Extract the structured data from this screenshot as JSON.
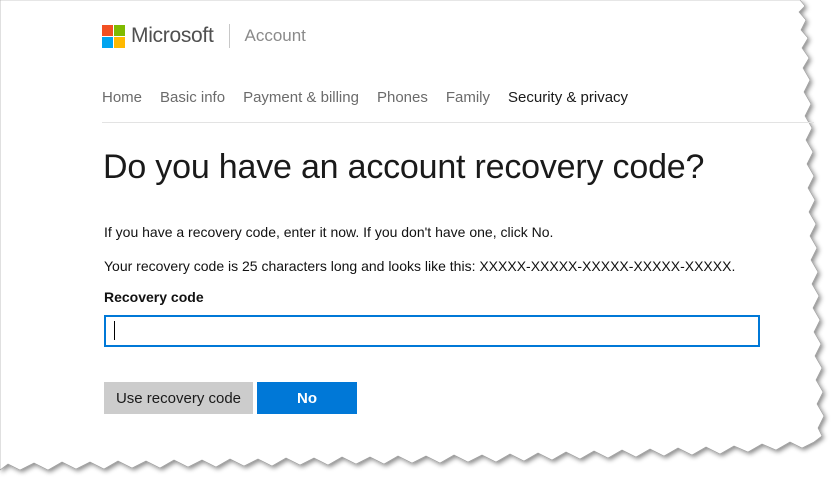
{
  "header": {
    "brand": "Microsoft",
    "section": "Account",
    "logo_colors": [
      "#f25022",
      "#7fba00",
      "#00a4ef",
      "#ffb900"
    ]
  },
  "nav": {
    "items": [
      {
        "label": "Home"
      },
      {
        "label": "Basic info"
      },
      {
        "label": "Payment & billing"
      },
      {
        "label": "Phones"
      },
      {
        "label": "Family"
      },
      {
        "label": "Security & privacy",
        "active": true
      }
    ]
  },
  "main": {
    "title": "Do you have an account recovery code?",
    "instruction": "If you have a recovery code, enter it now. If you don't have one, click No.",
    "format_hint": "Your recovery code is 25 characters long and looks like this: XXXXX-XXXXX-XXXXX-XXXXX-XXXXX.",
    "field_label": "Recovery code",
    "field_value": "",
    "use_button": "Use recovery code",
    "no_button": "No"
  },
  "colors": {
    "accent": "#0078d7",
    "secondary_button": "#cccccc"
  }
}
